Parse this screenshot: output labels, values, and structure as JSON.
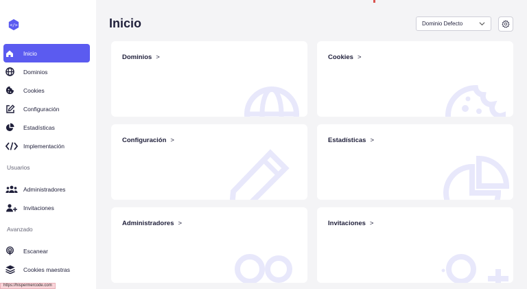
{
  "sidebar": {
    "items": [
      {
        "label": "Inicio",
        "icon": "home-icon",
        "active": true
      },
      {
        "label": "Dominios",
        "icon": "globe-icon"
      },
      {
        "label": "Cookies",
        "icon": "cookie-icon"
      },
      {
        "label": "Configuración",
        "icon": "edit-icon"
      },
      {
        "label": "Estadísticas",
        "icon": "pie-chart-icon"
      },
      {
        "label": "Implementación",
        "icon": "code-icon"
      }
    ],
    "section_users": "Usuarios",
    "users_items": [
      {
        "label": "Administradores",
        "icon": "users-icon"
      },
      {
        "label": "Invitaciones",
        "icon": "user-plus-icon"
      }
    ],
    "section_advanced": "Avanzado",
    "advanced_items": [
      {
        "label": "Escanear",
        "icon": "scan-icon"
      },
      {
        "label": "Cookies maestras",
        "icon": "layers-icon"
      }
    ]
  },
  "status_url": "https://hispermercode.com",
  "header": {
    "title": "Inicio",
    "domain_selected": "Dominio Defecto"
  },
  "cards": [
    {
      "title": "Dominios",
      "icon": "globe-icon"
    },
    {
      "title": "Cookies",
      "icon": "cookie-icon"
    },
    {
      "title": "Configuración",
      "icon": "edit-icon"
    },
    {
      "title": "Estadísticas",
      "icon": "pie-chart-icon"
    },
    {
      "title": "Administradores",
      "icon": "users-icon"
    },
    {
      "title": "Invitaciones",
      "icon": "user-plus-icon"
    }
  ],
  "colors": {
    "accent": "#5b5bf0",
    "background": "#f4f4f6",
    "card_icon": "#e8e8fb",
    "text": "#1f1f3a"
  }
}
